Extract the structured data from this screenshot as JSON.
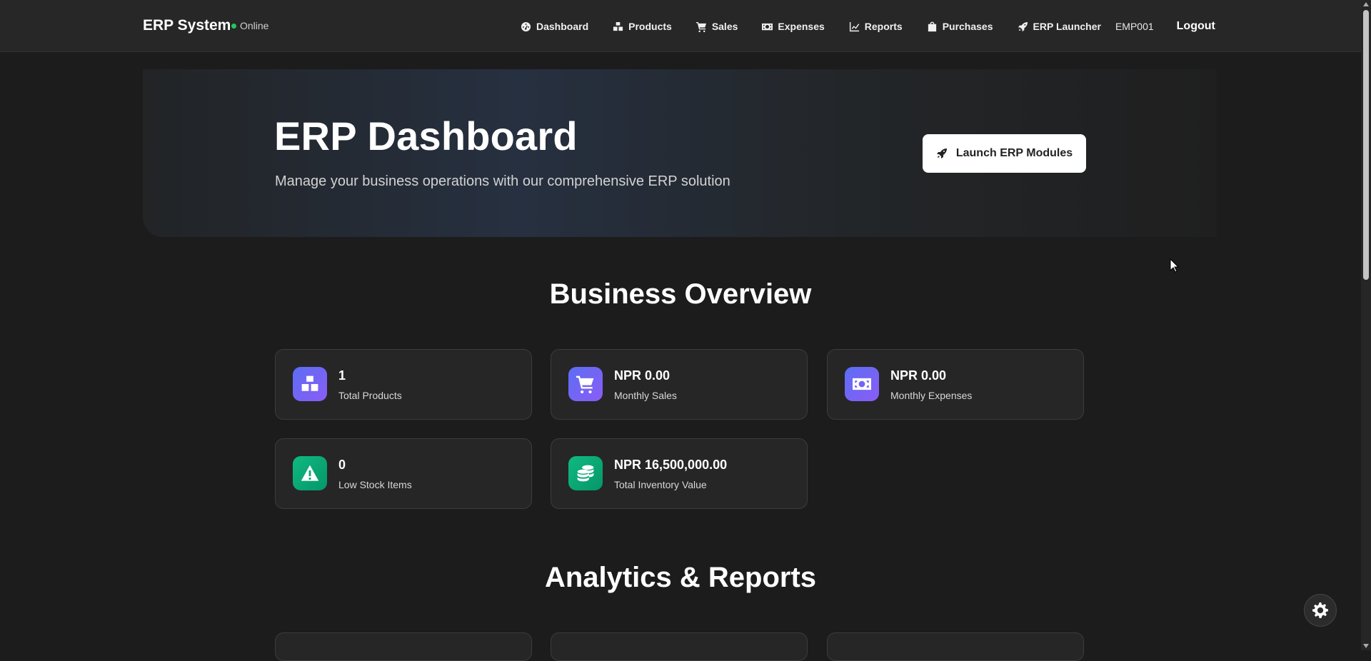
{
  "navbar": {
    "brand": "ERP System",
    "status": "Online",
    "items": [
      {
        "label": "Dashboard",
        "icon": "gauge-icon"
      },
      {
        "label": "Products",
        "icon": "boxes-icon"
      },
      {
        "label": "Sales",
        "icon": "cart-icon"
      },
      {
        "label": "Expenses",
        "icon": "money-bill-icon"
      },
      {
        "label": "Reports",
        "icon": "chart-line-icon"
      },
      {
        "label": "Purchases",
        "icon": "shopping-bag-icon"
      },
      {
        "label": "ERP Launcher",
        "icon": "rocket-icon"
      }
    ],
    "user": "EMP001",
    "logout": "Logout"
  },
  "hero": {
    "title": "ERP Dashboard",
    "subtitle": "Manage your business operations with our comprehensive ERP solution",
    "button": "Launch ERP Modules"
  },
  "overview": {
    "title": "Business Overview",
    "cards": [
      {
        "value": "1",
        "label": "Total Products",
        "icon": "boxes-icon",
        "color": "#6366f1"
      },
      {
        "value": "NPR 0.00",
        "label": "Monthly Sales",
        "icon": "cart-icon",
        "color": "#6366f1"
      },
      {
        "value": "NPR 0.00",
        "label": "Monthly Expenses",
        "icon": "money-bill-icon",
        "color": "#6366f1"
      },
      {
        "value": "0",
        "label": "Low Stock Items",
        "icon": "warning-icon",
        "color": "#10b981"
      },
      {
        "value": "NPR 16,500,000.00",
        "label": "Total Inventory Value",
        "icon": "coins-icon",
        "color": "#10b981"
      }
    ]
  },
  "analytics": {
    "title": "Analytics & Reports"
  },
  "colors": {
    "background": "#1c1c1c",
    "navbar": "#272727",
    "card": "#262626",
    "accent_purple": "#6366f1",
    "accent_green": "#10b981",
    "status_online": "#22c55e"
  }
}
